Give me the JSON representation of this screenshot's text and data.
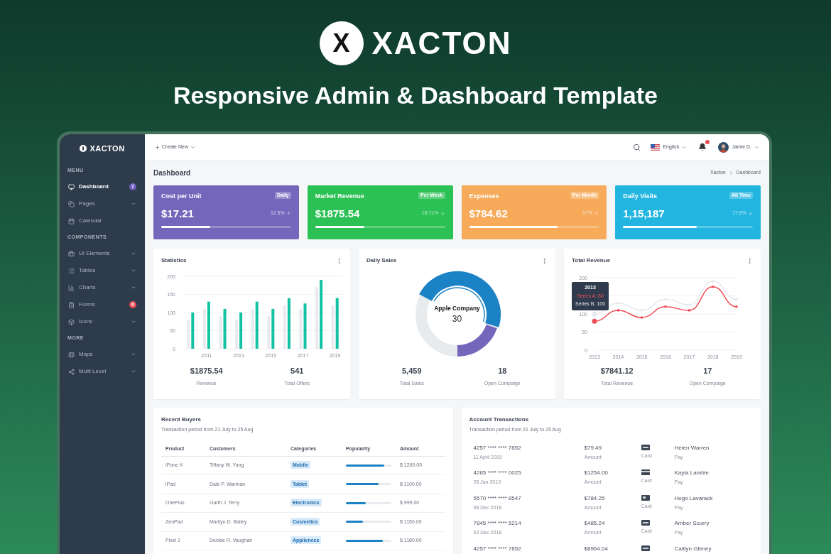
{
  "brand": {
    "mark": "X",
    "name": "XACTON"
  },
  "headline": "Responsive Admin & Dashboard Template",
  "sidebar": {
    "logo": "XACTON",
    "sections": [
      {
        "heading": "MENU",
        "items": [
          {
            "label": "Dashboard",
            "kind": "monitor",
            "selected": true,
            "expandable": false,
            "badge": {
              "text": "7",
              "color": "#6f61c0"
            }
          },
          {
            "label": "Pages",
            "kind": "pages",
            "selected": false,
            "expandable": true
          },
          {
            "label": "Calendar",
            "kind": "calendar",
            "selected": false,
            "expandable": false
          }
        ]
      },
      {
        "heading": "COMPONENTS",
        "items": [
          {
            "label": "UI Elements",
            "kind": "briefcase",
            "selected": false,
            "expandable": true
          },
          {
            "label": "Tables",
            "kind": "list",
            "selected": false,
            "expandable": true
          },
          {
            "label": "Charts",
            "kind": "chart",
            "selected": false,
            "expandable": true
          },
          {
            "label": "Forms",
            "kind": "form",
            "selected": false,
            "expandable": false,
            "badge": {
              "text": "6",
              "color": "#ef4d56"
            }
          },
          {
            "label": "Icons",
            "kind": "box",
            "selected": false,
            "expandable": true
          }
        ]
      },
      {
        "heading": "MORE",
        "items": [
          {
            "label": "Maps",
            "kind": "map",
            "selected": false,
            "expandable": true
          },
          {
            "label": "Multi Level",
            "kind": "share",
            "selected": false,
            "expandable": true
          }
        ]
      }
    ]
  },
  "topbar": {
    "create": "Create New",
    "language": "English",
    "has_notification": true,
    "user": "Jamie D."
  },
  "page": {
    "title": "Dashboard",
    "breadcrumb": [
      "Xacton",
      "Dashboard"
    ]
  },
  "stat_cards": [
    {
      "title": "Cost per Unit",
      "badge": "Daily",
      "value": "$17.21",
      "change": "12.5%",
      "rising": true,
      "level": 0.38,
      "color": "#7466bb"
    },
    {
      "title": "Market Revenue",
      "badge": "Per Week",
      "value": "$1875.54",
      "change": "18.71%",
      "rising": false,
      "level": 0.38,
      "color": "#2bc155"
    },
    {
      "title": "Expenses",
      "badge": "Per Month",
      "value": "$784.62",
      "change": "57%",
      "rising": true,
      "level": 0.68,
      "color": "#f6aa5a"
    },
    {
      "title": "Daily Visits",
      "badge": "All Time",
      "value": "1,15,187",
      "change": "17.8%",
      "rising": false,
      "level": 0.57,
      "color": "#22b5e0"
    }
  ],
  "statistics": {
    "title": "Statistics",
    "chart_data": {
      "type": "bar",
      "grid": true,
      "ylim": [
        0,
        200
      ],
      "yticks": [
        0,
        50,
        100,
        150,
        200
      ],
      "x": [
        2010,
        2011,
        2012,
        2013,
        2014,
        2015,
        2016,
        2017,
        2018,
        2019
      ],
      "xlim": [
        2009.5,
        2019.5
      ],
      "xticks": [
        2011,
        2013,
        2015,
        2017,
        2019
      ],
      "stacked": false,
      "series": [
        {
          "color": "#e9eaee",
          "values": [
            80,
            110,
            90,
            80,
            110,
            90,
            120,
            110,
            170,
            120
          ]
        },
        {
          "color": "#13c2a3",
          "values": [
            100,
            130,
            110,
            100,
            130,
            110,
            140,
            125,
            190,
            140
          ]
        }
      ]
    },
    "summary": [
      {
        "value": "$1875.54",
        "label": "Revenue"
      },
      {
        "value": "541",
        "label": "Total Offers"
      }
    ]
  },
  "daily_sales": {
    "title": "Daily Sales",
    "center_label": "Apple Company",
    "center_value": "30",
    "summary": [
      {
        "value": "5,459",
        "label": "Total Sales"
      },
      {
        "value": "18",
        "label": "Open Compaign"
      }
    ]
  },
  "total_revenue": {
    "title": "Total Revenue",
    "chart_data": {
      "type": "line",
      "grid": true,
      "x": [
        "2013",
        "2014",
        "2015",
        "2016",
        "2017",
        "2018",
        "2019"
      ],
      "ylim": [
        0,
        200
      ],
      "yticks": [
        0,
        50,
        100,
        200
      ],
      "series": [
        {
          "color": "#e6e8ec",
          "values": [
            100,
            130,
            110,
            140,
            125,
            190,
            140
          ]
        },
        {
          "color": "#ef4d56",
          "values": [
            80,
            110,
            90,
            120,
            110,
            175,
            120
          ]
        }
      ]
    },
    "tooltip": {
      "title": "2013",
      "lines": [
        {
          "text": "Series A: 80",
          "highlighted": true
        },
        {
          "text": "Series B: 100",
          "highlighted": false
        }
      ]
    },
    "summary": [
      {
        "value": "$7841.12",
        "label": "Total Revenue"
      },
      {
        "value": "17",
        "label": "Open Compaign"
      }
    ]
  },
  "recent_buyers": {
    "title": "Recent Buyers",
    "subtitle": "Transaction period from 21 July to 25 Aug",
    "columns": [
      "Product",
      "Customers",
      "Categories",
      "Popularity",
      "Amount"
    ],
    "rows": [
      {
        "product": "iPone X",
        "customer": "Tiffany W. Yang",
        "category": "Mobile",
        "level": 0.85,
        "amount": "$ 1200.00"
      },
      {
        "product": "iPad",
        "customer": "Dale P. Warman",
        "category": "Tablet",
        "level": 0.72,
        "amount": "$ 1190.00"
      },
      {
        "product": "OnePlus",
        "customer": "Garth J. Terry",
        "category": "Electronics",
        "level": 0.44,
        "amount": "$ 999.00"
      },
      {
        "product": "ZenPad",
        "customer": "Marilyn D. Bailey",
        "category": "Cosmetics",
        "level": 0.37,
        "amount": "$ 1150.00"
      },
      {
        "product": "Pixel 2",
        "customer": "Denise R. Vaughan",
        "category": "Appliences",
        "level": 0.82,
        "amount": "$ 1180.00"
      }
    ]
  },
  "transactions": {
    "title": "Account Transactions",
    "subtitle": "Transaction period from 21 July to 25 Aug",
    "rows": [
      {
        "card_number": "4257 **** **** 7852",
        "date": "11 April 2019",
        "amount": "$79.49",
        "amount_label": "Amount",
        "kind": "visa",
        "card_label": "Card",
        "name": "Helen Warren",
        "pay_label": "Pay"
      },
      {
        "card_number": "4265 **** **** 0025",
        "date": "28 Jan 2019",
        "amount": "$1254.00",
        "amount_label": "Amount",
        "kind": "band",
        "card_label": "Card",
        "name": "Kayla Lambie",
        "pay_label": "Pay"
      },
      {
        "card_number": "5570 **** **** 8547",
        "date": "08 Dec 2018",
        "amount": "$784.25",
        "amount_label": "Amount",
        "kind": "chip",
        "card_label": "Card",
        "name": "Hugo Lavarack",
        "pay_label": "Pay"
      },
      {
        "card_number": "7845 **** **** 5214",
        "date": "03 Dec 2018",
        "amount": "$485.24",
        "amount_label": "Amount",
        "kind": "visa",
        "card_label": "Card",
        "name": "Amber Scurry",
        "pay_label": "Pay"
      },
      {
        "card_number": "4257 **** **** 7852",
        "amount": "$8964.04",
        "kind": "visa",
        "name": "Caitlyn Gibney"
      }
    ]
  }
}
